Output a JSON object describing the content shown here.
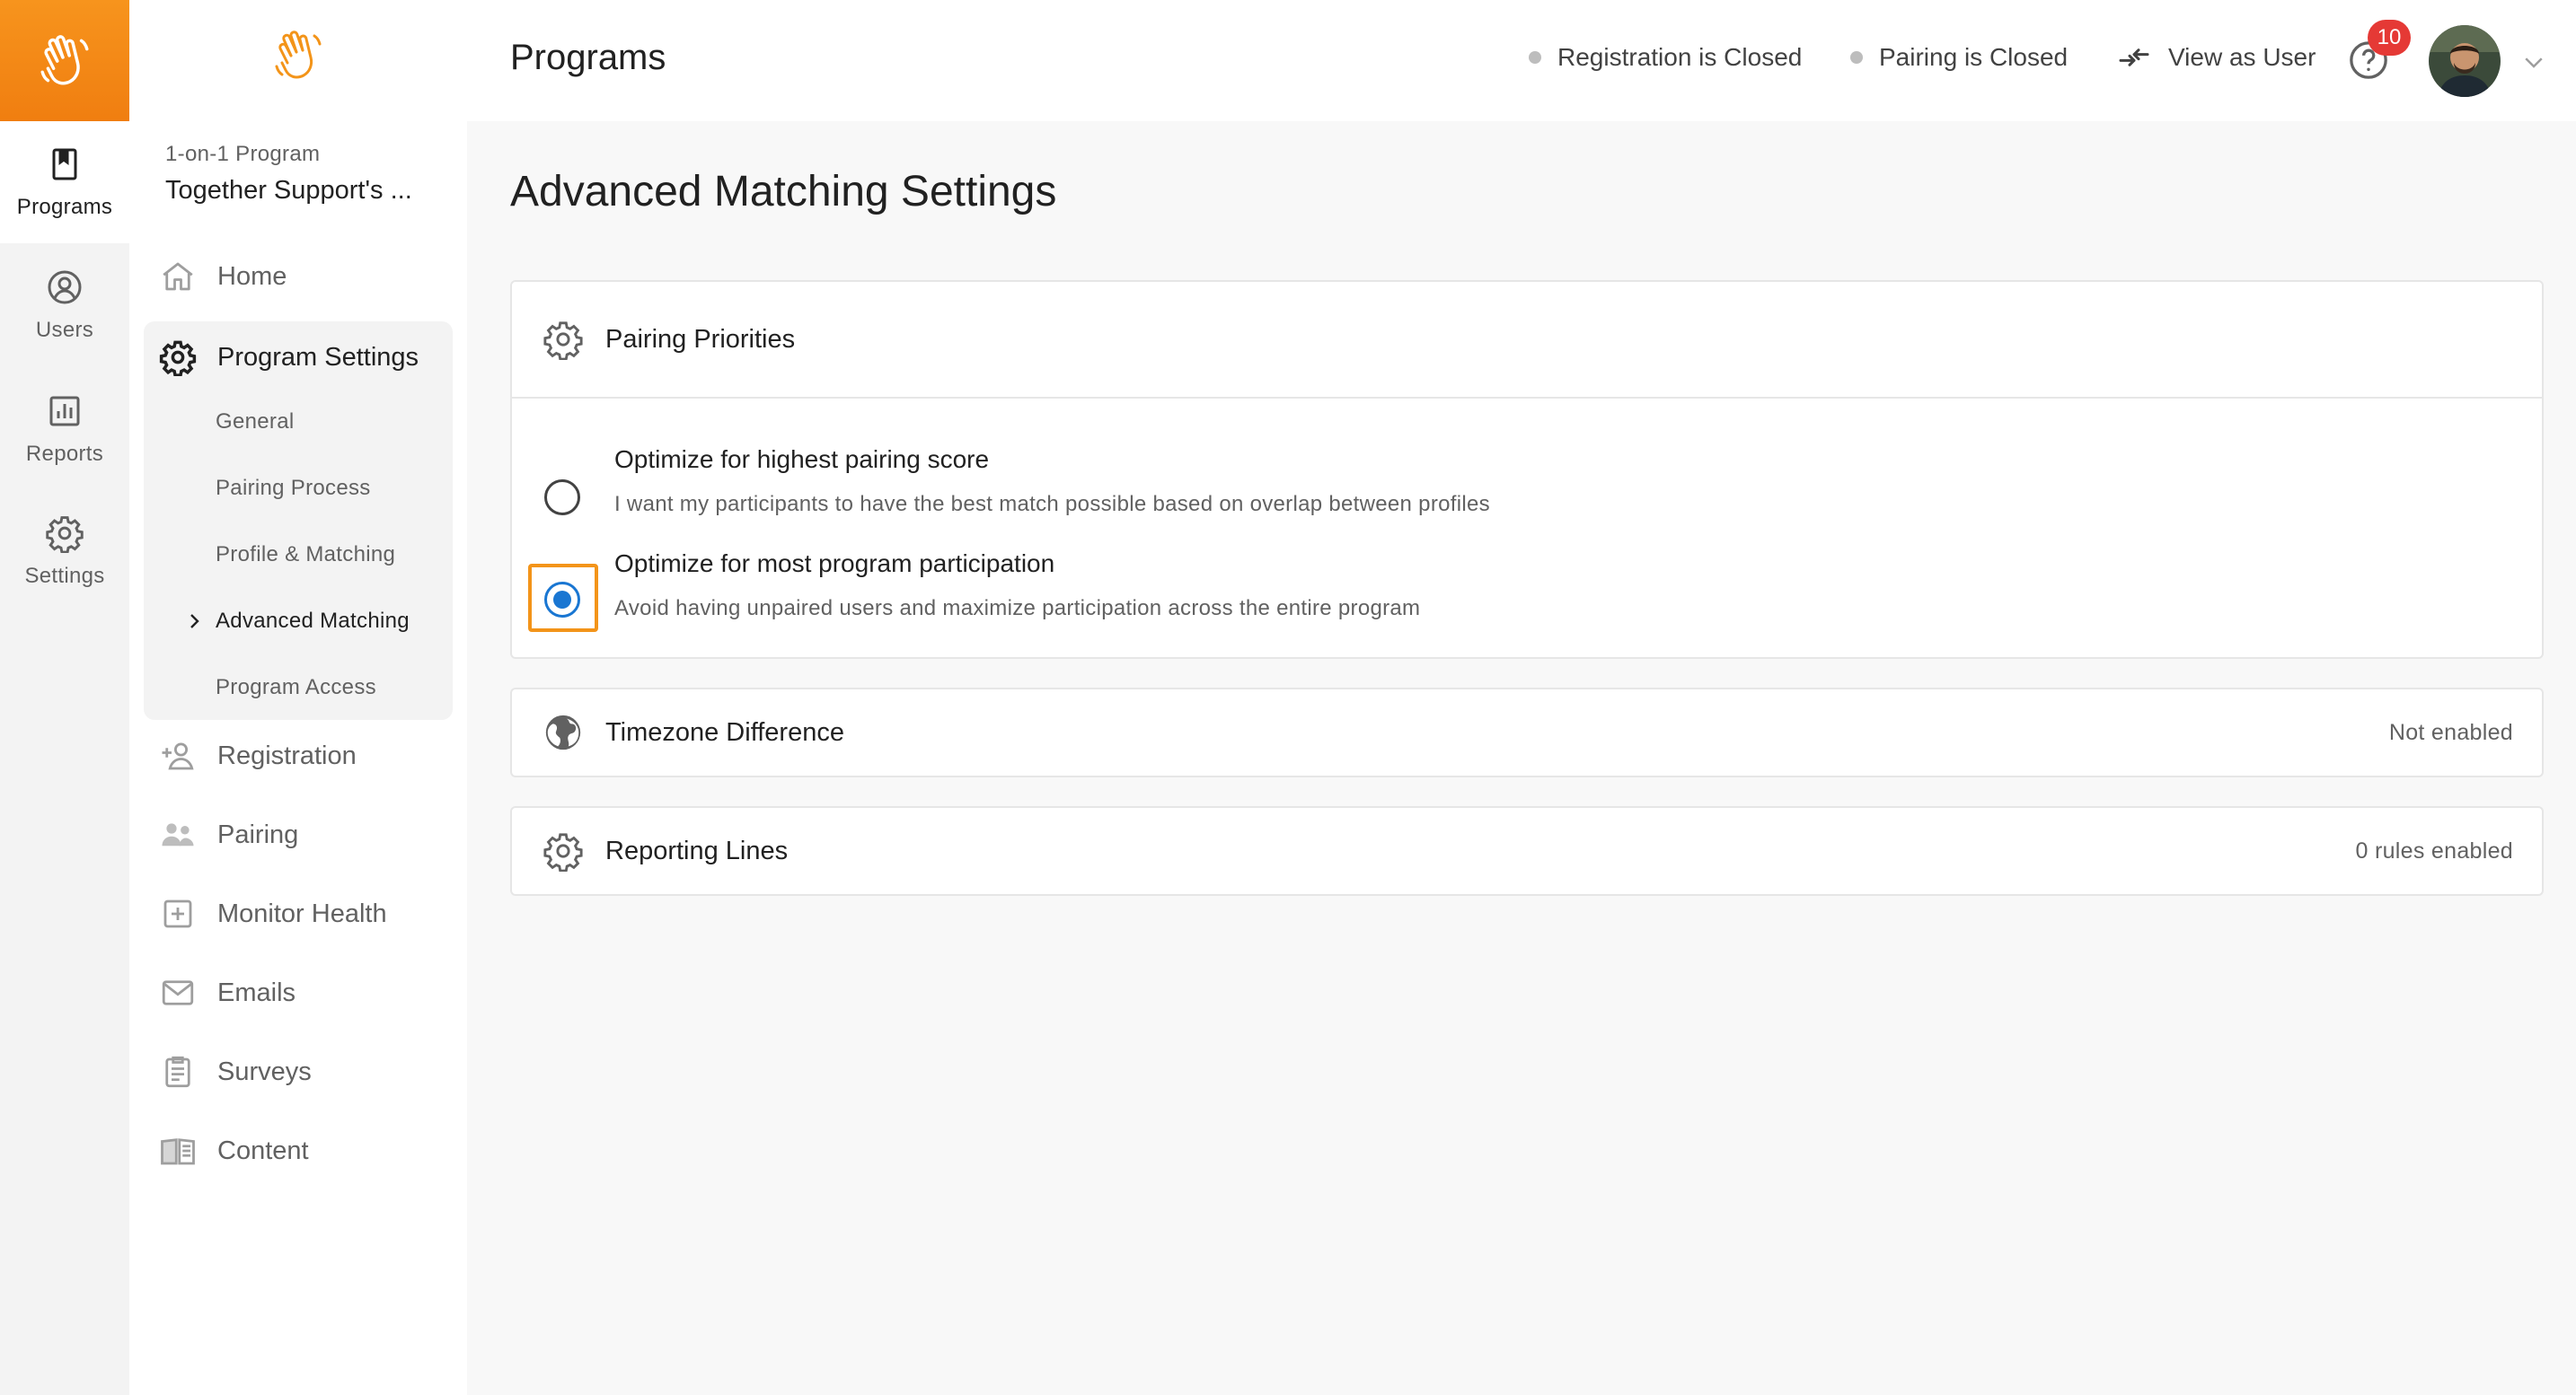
{
  "colors": {
    "accent": "#f39419",
    "primary": "#1976d2",
    "badge": "#e53935"
  },
  "rail": {
    "logo_icon": "waving-hand-icon",
    "items": [
      {
        "label": "Programs",
        "icon": "bookmark-book-icon",
        "active": true
      },
      {
        "label": "Users",
        "icon": "user-circle-icon",
        "active": false
      },
      {
        "label": "Reports",
        "icon": "bar-chart-icon",
        "active": false
      },
      {
        "label": "Settings",
        "icon": "gear-icon",
        "active": false
      }
    ]
  },
  "sidebar": {
    "program_type": "1-on-1 Program",
    "program_name": "Together Support's ...",
    "nav": {
      "home": "Home",
      "program_settings": "Program Settings",
      "registration": "Registration",
      "pairing": "Pairing",
      "monitor_health": "Monitor Health",
      "emails": "Emails",
      "surveys": "Surveys",
      "content": "Content"
    },
    "settings_sub": [
      "General",
      "Pairing Process",
      "Profile & Matching",
      "Advanced Matching",
      "Program Access"
    ],
    "active_sub": "Advanced Matching"
  },
  "header": {
    "title": "Programs",
    "registration_status": "Registration is Closed",
    "pairing_status": "Pairing is Closed",
    "view_as_user": "View as User",
    "notification_count": "10"
  },
  "main": {
    "title": "Advanced Matching Settings",
    "pairing_priorities": {
      "title": "Pairing Priorities",
      "options": [
        {
          "title": "Optimize for highest pairing score",
          "description": "I want my participants to have the best match possible based on overlap between profiles",
          "selected": false
        },
        {
          "title": "Optimize for most program participation",
          "description": "Avoid having unpaired users and maximize participation across the entire program",
          "selected": true
        }
      ]
    },
    "timezone": {
      "title": "Timezone Difference",
      "status": "Not enabled"
    },
    "reporting_lines": {
      "title": "Reporting Lines",
      "status": "0 rules enabled"
    }
  }
}
